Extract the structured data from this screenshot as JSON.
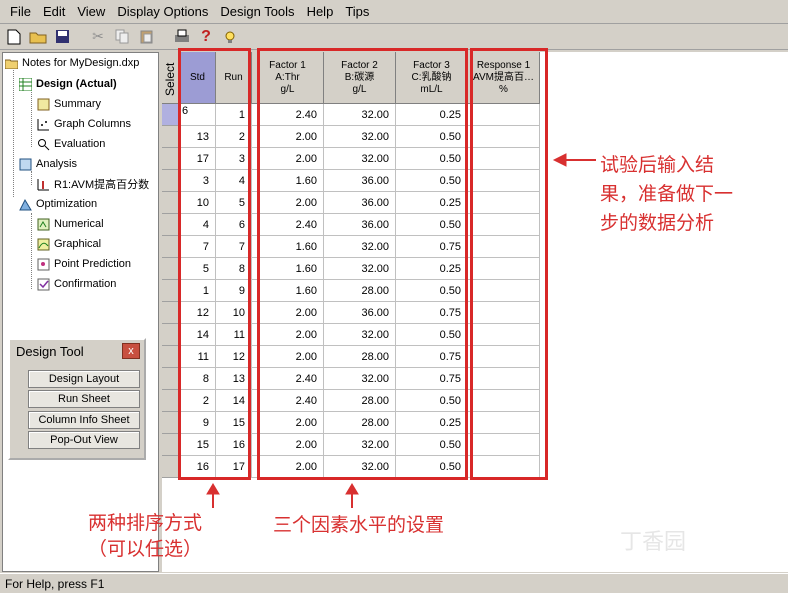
{
  "menu": [
    "File",
    "Edit",
    "View",
    "Display Options",
    "Design Tools",
    "Help",
    "Tips"
  ],
  "tree": {
    "root": "Notes for MyDesign.dxp",
    "design": "Design (Actual)",
    "summary": "Summary",
    "graph_columns": "Graph Columns",
    "evaluation": "Evaluation",
    "analysis": "Analysis",
    "r1": "R1:AVM提高百分数",
    "optimization": "Optimization",
    "numerical": "Numerical",
    "graphical": "Graphical",
    "point_prediction": "Point Prediction",
    "confirmation": "Confirmation"
  },
  "design_tool": {
    "title": "Design Tool",
    "close": "x",
    "buttons": [
      "Design Layout",
      "Run Sheet",
      "Column Info Sheet",
      "Pop-Out View"
    ]
  },
  "grid": {
    "select_label": "Select",
    "headers": {
      "std": "Std",
      "run": "Run",
      "f1": [
        "Factor 1",
        "A:Thr",
        "g/L"
      ],
      "f2": [
        "Factor 2",
        "B:碳源",
        "g/L"
      ],
      "f3": [
        "Factor 3",
        "C:乳酸钠",
        "mL/L"
      ],
      "r1": [
        "Response 1",
        "AVM提高百…",
        "%"
      ]
    },
    "rows": [
      {
        "std": "6",
        "run": "1",
        "a": "2.40",
        "b": "32.00",
        "c": "0.25"
      },
      {
        "std": "13",
        "run": "2",
        "a": "2.00",
        "b": "32.00",
        "c": "0.50"
      },
      {
        "std": "17",
        "run": "3",
        "a": "2.00",
        "b": "32.00",
        "c": "0.50"
      },
      {
        "std": "3",
        "run": "4",
        "a": "1.60",
        "b": "36.00",
        "c": "0.50"
      },
      {
        "std": "10",
        "run": "5",
        "a": "2.00",
        "b": "36.00",
        "c": "0.25"
      },
      {
        "std": "4",
        "run": "6",
        "a": "2.40",
        "b": "36.00",
        "c": "0.50"
      },
      {
        "std": "7",
        "run": "7",
        "a": "1.60",
        "b": "32.00",
        "c": "0.75"
      },
      {
        "std": "5",
        "run": "8",
        "a": "1.60",
        "b": "32.00",
        "c": "0.25"
      },
      {
        "std": "1",
        "run": "9",
        "a": "1.60",
        "b": "28.00",
        "c": "0.50"
      },
      {
        "std": "12",
        "run": "10",
        "a": "2.00",
        "b": "36.00",
        "c": "0.75"
      },
      {
        "std": "14",
        "run": "11",
        "a": "2.00",
        "b": "32.00",
        "c": "0.50"
      },
      {
        "std": "11",
        "run": "12",
        "a": "2.00",
        "b": "28.00",
        "c": "0.75"
      },
      {
        "std": "8",
        "run": "13",
        "a": "2.40",
        "b": "32.00",
        "c": "0.75"
      },
      {
        "std": "2",
        "run": "14",
        "a": "2.40",
        "b": "28.00",
        "c": "0.50"
      },
      {
        "std": "9",
        "run": "15",
        "a": "2.00",
        "b": "28.00",
        "c": "0.25"
      },
      {
        "std": "15",
        "run": "16",
        "a": "2.00",
        "b": "32.00",
        "c": "0.50"
      },
      {
        "std": "16",
        "run": "17",
        "a": "2.00",
        "b": "32.00",
        "c": "0.50"
      }
    ]
  },
  "annotations": {
    "right": [
      "试验后输入结",
      "果，准备做下一",
      "步的数据分析"
    ],
    "bottom_left": [
      "两种排序方式",
      "（可以任选）"
    ],
    "bottom_mid": "三个因素水平的设置"
  },
  "status": "For Help, press F1",
  "watermark": "丁香园",
  "colors": {
    "annotation": "#d83030",
    "selected_header": "#9c9cd4"
  }
}
